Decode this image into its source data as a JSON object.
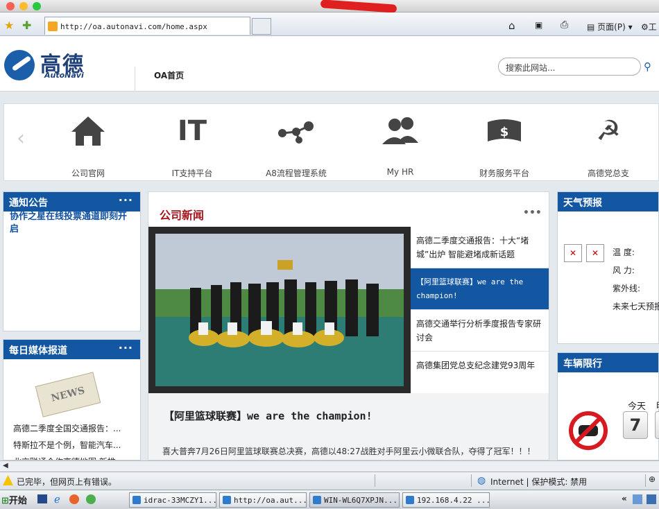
{
  "browser": {
    "url": "http://oa.autonavi.com/home.aspx",
    "toolbar": {
      "home": "⌂",
      "rss": "▣",
      "print": "⎙",
      "page_menu": "页面(P)",
      "tools_menu": "工"
    }
  },
  "header": {
    "logo_cn": "高德",
    "logo_en": "AutoNavi",
    "nav_home": "OA首页",
    "search_placeholder": "搜索此网站..."
  },
  "quick_links": [
    {
      "label": "公司官网",
      "icon": "house-icon"
    },
    {
      "label": "IT支持平台",
      "icon": "it-icon",
      "glyph": "IT"
    },
    {
      "label": "A8流程管理系统",
      "icon": "workflow-icon"
    },
    {
      "label": "My HR",
      "icon": "people-icon"
    },
    {
      "label": "财务服务平台",
      "icon": "money-icon"
    },
    {
      "label": "高德党总支",
      "icon": "party-emblem-icon"
    }
  ],
  "notice": {
    "title": "通知公告",
    "more": "···",
    "items": [
      "协作之星在线投票通道即刻开启"
    ]
  },
  "media": {
    "title": "每日媒体报道",
    "more": "···",
    "items": [
      "高德二季度全国交通报告：...",
      "特斯拉不是个例，智能汽车...",
      "北京联通合作高德地图 新推..."
    ]
  },
  "news": {
    "title": "公司新闻",
    "more": "•••",
    "items": [
      "高德二季度交通报告：十大“堵城”出炉 智能避堵成新话题",
      "【阿里篮球联赛】we are the champion!",
      "高德交通举行分析季度报告专家研讨会",
      "高德集团党总支纪念建党93周年"
    ],
    "caption_title": "【阿里篮球联赛】we are the champion!",
    "caption_text": "喜大普奔7月26日阿里篮球联赛总决赛，高德以48:27战胜对手阿里云小微联合队，夺得了冠军！！！"
  },
  "weather": {
    "title": "天气预报",
    "temp_label": "温  度:",
    "wind_label": "风  力:",
    "uv_label": "紫外线:",
    "forecast_label": "未来七天预报"
  },
  "traffic": {
    "title": "车辆限行",
    "today_label": "今天",
    "today_number": "7",
    "next_label": "明"
  },
  "status": {
    "text": "已完毕，但网页上有错误。",
    "zone": "Internet | 保护模式: 禁用"
  },
  "taskbar": {
    "start": "开始",
    "tasks": [
      "idrac-33MCZY1...",
      "http://oa.aut...",
      "WIN-WL6Q7XPJN...",
      "192.168.4.22 ..."
    ]
  }
}
